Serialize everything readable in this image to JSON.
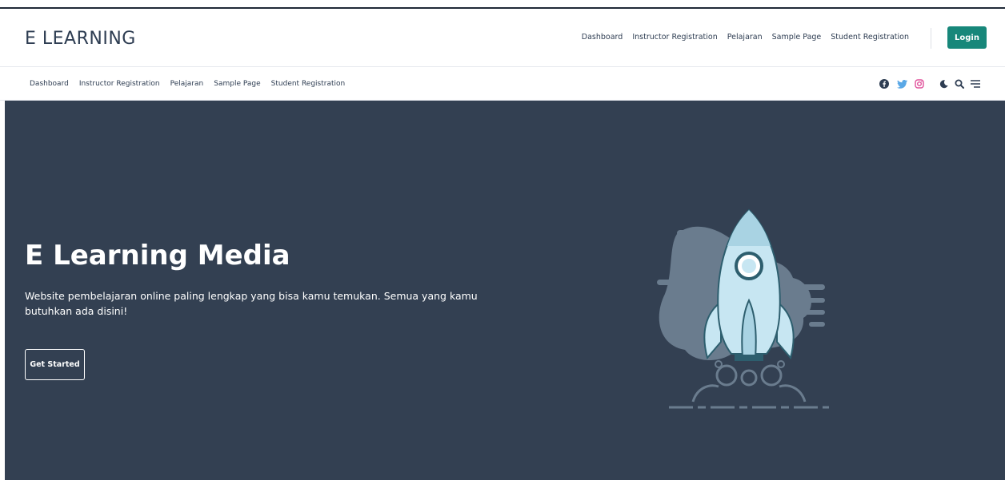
{
  "brand": "E LEARNING",
  "header_nav": [
    "Dashboard",
    "Instructor Registration",
    "Pelajaran",
    "Sample Page",
    "Student Registration"
  ],
  "login_label": "Login",
  "sub_nav": [
    "Dashboard",
    "Instructor Registration",
    "Pelajaran",
    "Sample Page",
    "Student Registration"
  ],
  "hero": {
    "title": "E Learning Media",
    "text": "Website pembelajaran online paling lengkap yang bisa kamu temukan. Semua yang kamu butuhkan ada disini!",
    "cta": "Get Started"
  },
  "icons": [
    "facebook-icon",
    "twitter-icon",
    "instagram-icon",
    "moon-icon",
    "search-icon",
    "menu-icon"
  ],
  "colors": {
    "accent": "#17877a",
    "hero_bg": "#334052",
    "text": "#2e3d52"
  }
}
